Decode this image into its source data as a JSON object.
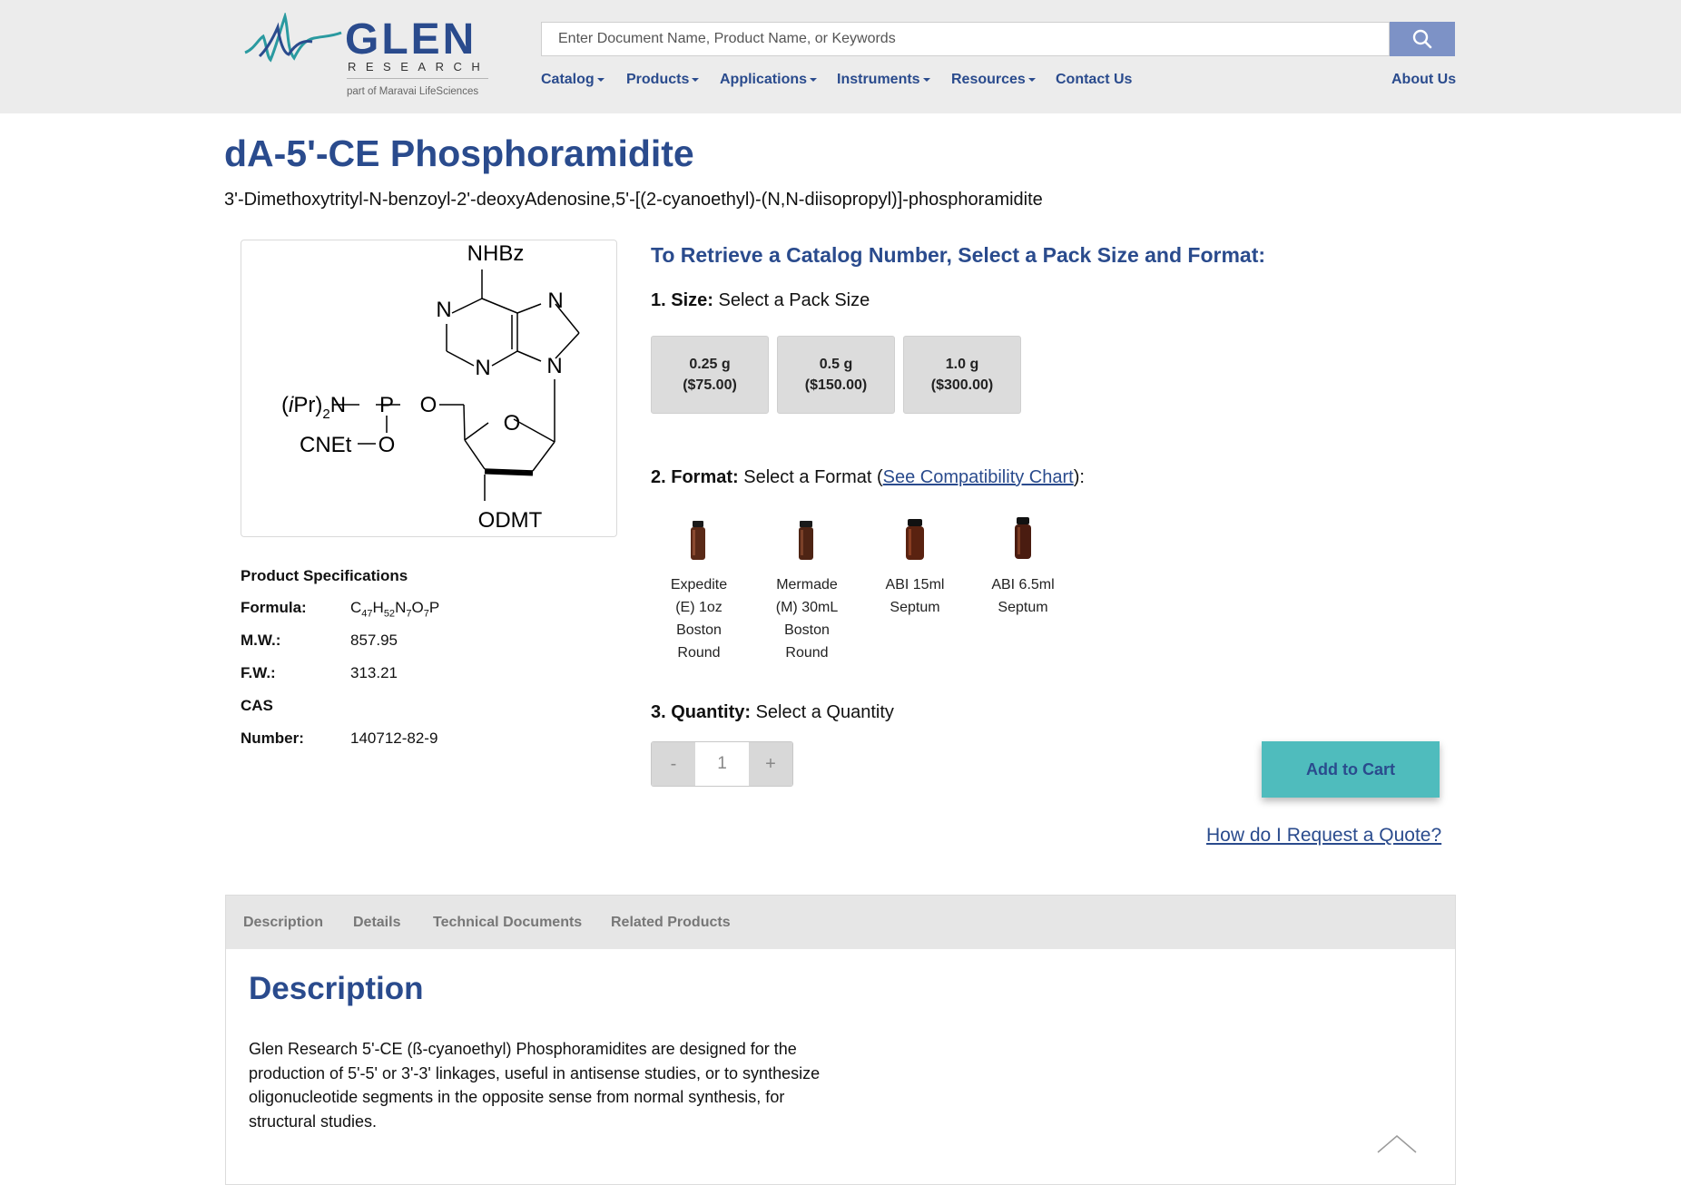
{
  "brand": {
    "name": "GLEN",
    "subname": "RESEARCH",
    "tagline": "part of Maravai LifeSciences",
    "color_primary": "#2a4b8d",
    "color_accent": "#4fbcbd"
  },
  "search": {
    "placeholder": "Enter Document Name, Product Name, or Keywords",
    "icon": "search-icon"
  },
  "nav": {
    "items": [
      {
        "label": "Catalog"
      },
      {
        "label": "Products"
      },
      {
        "label": "Applications"
      },
      {
        "label": "Instruments"
      },
      {
        "label": "Resources"
      },
      {
        "label": "Contact Us"
      }
    ],
    "about": "About Us"
  },
  "product": {
    "title": "dA-5'-CE Phosphoramidite",
    "subtitle": "3'-Dimethoxytrityl-N-benzoyl-2'-deoxyAdenosine,5'-[(2-cyanoethyl)-(N,N-diisopropyl)]-phosphoramidite"
  },
  "structure": {
    "nhbz": "NHBz",
    "n": "N",
    "o": "O",
    "p": "P",
    "ipr_pre": "(",
    "ipr_i": "i",
    "ipr_pr": "Pr)",
    "ipr_sub": "2",
    "ipr_n": "N",
    "cnet": "CNEt",
    "odmt": "ODMT"
  },
  "specs": {
    "heading": "Product Specifications",
    "formula_label": "Formula:",
    "formula": {
      "c": "C",
      "c_n": "47",
      "h": "H",
      "h_n": "52",
      "n": "N",
      "n_n": "7",
      "o": "O",
      "o_n": "7",
      "p": "P"
    },
    "mw_label": "M.W.:",
    "mw": "857.95",
    "fw_label": "F.W.:",
    "fw": "313.21",
    "cas_label_1": "CAS",
    "cas_label_2": "Number:",
    "cas": "140712-82-9"
  },
  "order": {
    "heading": "To Retrieve a Catalog Number, Select a Pack Size and Format:",
    "size_step_num": "1. Size:",
    "size_step_text": " Select a Pack Size",
    "sizes": [
      {
        "amount": "0.25 g",
        "price": "($75.00)"
      },
      {
        "amount": "0.5 g",
        "price": "($150.00)"
      },
      {
        "amount": "1.0 g",
        "price": "($300.00)"
      }
    ],
    "format_step_num": "2. Format:",
    "format_step_text": " Select a Format (",
    "format_link": "See Compatibility Chart",
    "format_step_end": "):",
    "formats": [
      {
        "lines": [
          "Expedite",
          "(E) 1oz",
          "Boston",
          "Round"
        ]
      },
      {
        "lines": [
          "Mermade",
          "(M) 30mL",
          "Boston",
          "Round"
        ]
      },
      {
        "lines": [
          "ABI 15ml",
          "Septum"
        ]
      },
      {
        "lines": [
          "ABI 6.5ml",
          "Septum"
        ]
      }
    ],
    "qty_step_num": "3. Quantity:",
    "qty_step_text": " Select a Quantity",
    "qty_minus": "-",
    "qty_value": "1",
    "qty_plus": "+",
    "add_to_cart": "Add to Cart",
    "quote_link": "How do I Request a Quote?"
  },
  "tabs": {
    "items": [
      {
        "label": "Description"
      },
      {
        "label": "Details"
      },
      {
        "label": "Technical Documents"
      },
      {
        "label": "Related Products"
      }
    ],
    "active": "Description"
  },
  "description": {
    "title": "Description",
    "text": "Glen Research 5'-CE (ß-cyanoethyl) Phosphoramidites are designed for the production of 5'-5' or 3'-3' linkages, useful in antisense studies, or to synthesize oligonucleotide segments in the opposite sense from normal synthesis, for structural studies."
  }
}
